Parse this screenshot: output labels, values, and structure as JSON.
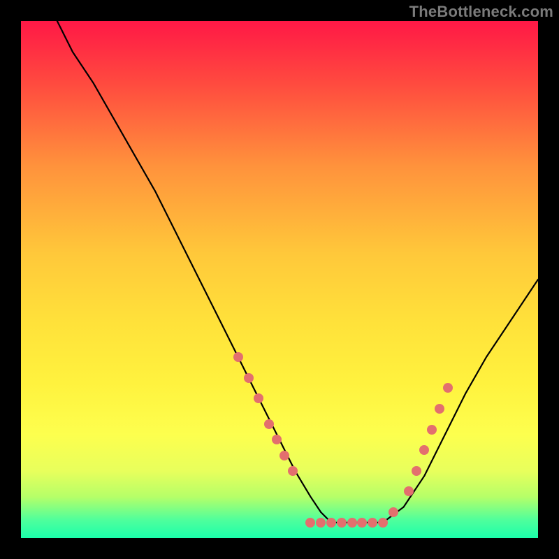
{
  "watermark": "TheBottleneck.com",
  "colors": {
    "gradient_stops": [
      "#ff1846",
      "#ff4a3f",
      "#ff923c",
      "#ffc83a",
      "#ffe13a",
      "#fff23e",
      "#fdff4e",
      "#e8ff5c",
      "#b6ff68",
      "#4fff9c",
      "#1bffab"
    ],
    "marker": "#e36f6e",
    "curve": "#000000",
    "background": "#000000"
  },
  "chart_data": {
    "type": "line",
    "title": "",
    "xlabel": "",
    "ylabel": "",
    "xlim": [
      0,
      100
    ],
    "ylim": [
      0,
      100
    ],
    "series": [
      {
        "name": "bottleneck-curve",
        "x": [
          7,
          10,
          14,
          18,
          22,
          26,
          30,
          34,
          38,
          42,
          46,
          50,
          53,
          56,
          58,
          60,
          62,
          64,
          67,
          70,
          74,
          78,
          82,
          86,
          90,
          94,
          100
        ],
        "y": [
          100,
          94,
          88,
          81,
          74,
          67,
          59,
          51,
          43,
          35,
          27,
          19,
          13,
          8,
          5,
          3,
          3,
          3,
          3,
          3,
          6,
          12,
          20,
          28,
          35,
          41,
          50
        ]
      }
    ],
    "markers": [
      {
        "x": 42,
        "y": 35
      },
      {
        "x": 44,
        "y": 31
      },
      {
        "x": 46,
        "y": 27
      },
      {
        "x": 48,
        "y": 22
      },
      {
        "x": 49.5,
        "y": 19
      },
      {
        "x": 51,
        "y": 16
      },
      {
        "x": 52.5,
        "y": 13
      },
      {
        "x": 56,
        "y": 3
      },
      {
        "x": 58,
        "y": 3
      },
      {
        "x": 60,
        "y": 3
      },
      {
        "x": 62,
        "y": 3
      },
      {
        "x": 64,
        "y": 3
      },
      {
        "x": 66,
        "y": 3
      },
      {
        "x": 68,
        "y": 3
      },
      {
        "x": 70,
        "y": 3
      },
      {
        "x": 72,
        "y": 5
      },
      {
        "x": 75,
        "y": 9
      },
      {
        "x": 76.5,
        "y": 13
      },
      {
        "x": 78,
        "y": 17
      },
      {
        "x": 79.5,
        "y": 21
      },
      {
        "x": 81,
        "y": 25
      },
      {
        "x": 82.5,
        "y": 29
      }
    ]
  }
}
